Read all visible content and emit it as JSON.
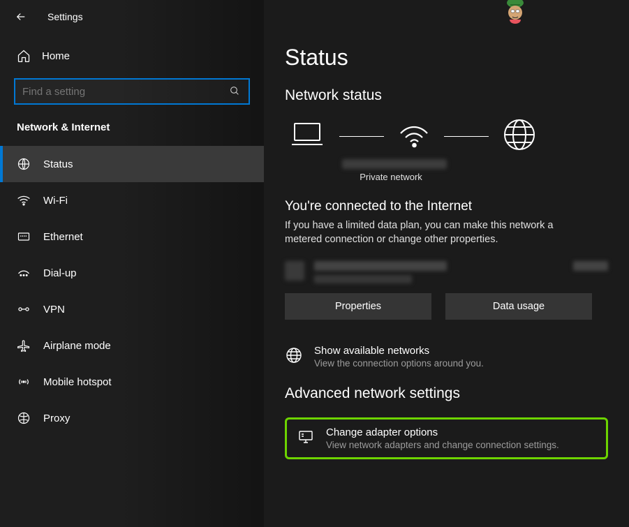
{
  "header": {
    "title": "Settings"
  },
  "home": {
    "label": "Home"
  },
  "search": {
    "placeholder": "Find a setting"
  },
  "category": "Network & Internet",
  "nav": [
    {
      "icon": "globe",
      "label": "Status",
      "active": true
    },
    {
      "icon": "wifi",
      "label": "Wi-Fi"
    },
    {
      "icon": "ethernet",
      "label": "Ethernet"
    },
    {
      "icon": "dialup",
      "label": "Dial-up"
    },
    {
      "icon": "vpn",
      "label": "VPN"
    },
    {
      "icon": "airplane",
      "label": "Airplane mode"
    },
    {
      "icon": "hotspot",
      "label": "Mobile hotspot"
    },
    {
      "icon": "proxy",
      "label": "Proxy"
    }
  ],
  "main": {
    "page_title": "Status",
    "section_title": "Network status",
    "diagram_label": "Private network",
    "connected_title": "You're connected to the Internet",
    "connected_desc": "If you have a limited data plan, you can make this network a metered connection or change other properties.",
    "btn_properties": "Properties",
    "btn_data_usage": "Data usage",
    "show_networks": {
      "title": "Show available networks",
      "desc": "View the connection options around you."
    },
    "adv_title": "Advanced network settings",
    "change_adapter": {
      "title": "Change adapter options",
      "desc": "View network adapters and change connection settings."
    }
  }
}
